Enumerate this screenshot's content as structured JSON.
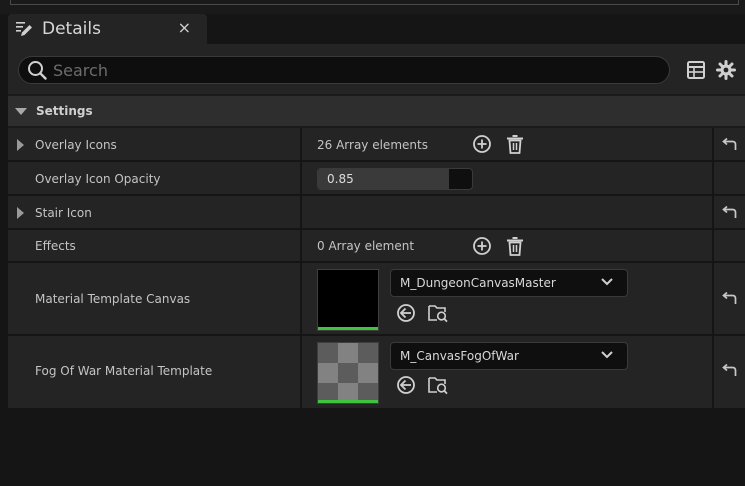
{
  "tab": {
    "title": "Details",
    "close": "×"
  },
  "search": {
    "placeholder": "Search",
    "value": ""
  },
  "section": {
    "title": "Settings"
  },
  "rows": [
    {
      "name": "Overlay Icons",
      "value": "26 Array elements"
    },
    {
      "name": "Overlay Icon Opacity",
      "value": "0.85",
      "fraction": 0.85
    },
    {
      "name": "Stair Icon"
    },
    {
      "name": "Effects",
      "value": "0 Array element"
    },
    {
      "name": "Material Template Canvas",
      "asset": "M_DungeonCanvasMaster"
    },
    {
      "name": "Fog Of War Material Template",
      "asset": "M_CanvasFogOfWar"
    }
  ],
  "icons": {
    "tab": "pencil-icon",
    "search": "search-icon",
    "table": "table-icon",
    "settings": "gear-icon",
    "add": "plus-circle-icon",
    "delete": "trash-icon",
    "reset": "reset-arrow-icon",
    "use_selected": "arrow-left-circle-icon",
    "browse": "folder-search-icon"
  },
  "colors": {
    "background": "#151515",
    "panel": "#242424",
    "section": "#2e2e2e",
    "thumbnail_underline": "#3ec43e"
  }
}
